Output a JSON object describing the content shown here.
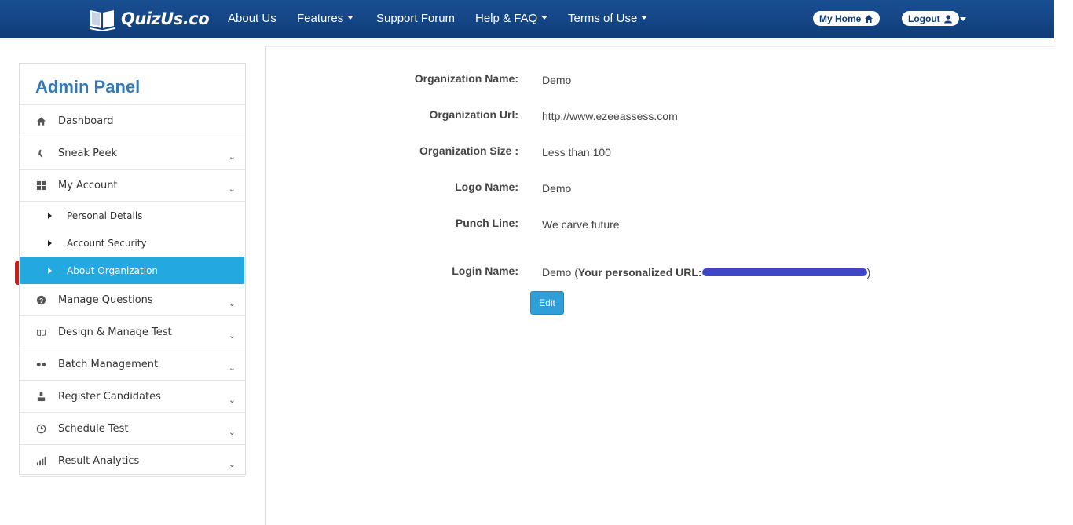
{
  "brand": {
    "name": "QuizUs.co"
  },
  "nav": {
    "about": "About Us",
    "features": "Features",
    "support": "Support Forum",
    "help": "Help & FAQ",
    "terms": "Terms of Use",
    "my_home": "My Home",
    "logout": "Logout"
  },
  "sidebar": {
    "title": "Admin Panel",
    "items": [
      {
        "label": "Dashboard",
        "icon": "home-icon"
      },
      {
        "label": "Sneak Peek",
        "icon": "peek-icon"
      },
      {
        "label": "My Account",
        "icon": "grid-icon"
      },
      {
        "label": "Manage Questions",
        "icon": "question-icon"
      },
      {
        "label": "Design & Manage Test",
        "icon": "book-icon"
      },
      {
        "label": "Batch Management",
        "icon": "dots-icon"
      },
      {
        "label": "Register Candidates",
        "icon": "user-icon"
      },
      {
        "label": "Schedule Test",
        "icon": "clock-icon"
      },
      {
        "label": "Result Analytics",
        "icon": "bar-chart-icon"
      }
    ],
    "subitems": [
      {
        "label": "Personal Details"
      },
      {
        "label": "Account Security"
      },
      {
        "label": "About Organization"
      }
    ]
  },
  "org": {
    "name_label": "Organization Name:",
    "name_value": "Demo",
    "url_label": "Organization Url:",
    "url_value": "http://www.ezeeassess.com",
    "size_label": "Organization Size :",
    "size_value": "Less than 100",
    "logo_label": "Logo Name:",
    "logo_value": "Demo",
    "punch_label": "Punch Line:",
    "punch_value": "We carve future",
    "login_label": "Login Name:",
    "login_value": "Demo",
    "login_paren_open": " (",
    "personal_url_label": "Your personalized URL:",
    "login_paren_close": ")",
    "edit_button": "Edit"
  }
}
